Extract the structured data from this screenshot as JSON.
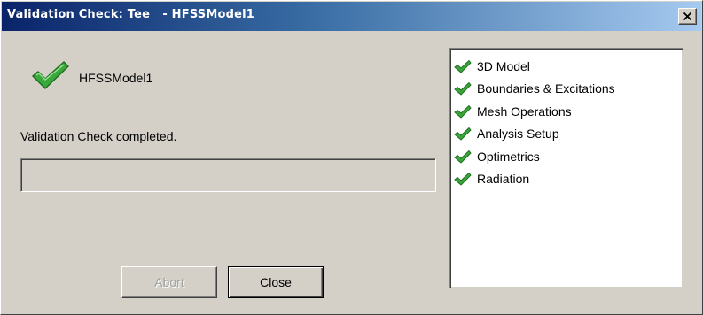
{
  "window": {
    "title": "Validation Check: Tee   - HFSSModel1"
  },
  "main": {
    "model_name": "HFSSModel1",
    "status": "Validation Check completed.",
    "abort_label": "Abort",
    "close_label": "Close"
  },
  "checklist": {
    "items": [
      {
        "label": "3D Model",
        "icon": "check-icon"
      },
      {
        "label": "Boundaries & Excitations",
        "icon": "check-icon"
      },
      {
        "label": "Mesh Operations",
        "icon": "check-icon"
      },
      {
        "label": "Analysis Setup",
        "icon": "check-icon"
      },
      {
        "label": "Optimetrics",
        "icon": "check-icon"
      },
      {
        "label": "Radiation",
        "icon": "check-icon"
      }
    ]
  },
  "colors": {
    "check_green": "#3aa83a",
    "titlebar_start": "#0a246a",
    "titlebar_end": "#a6caf0",
    "face": "#d4d0c8"
  }
}
